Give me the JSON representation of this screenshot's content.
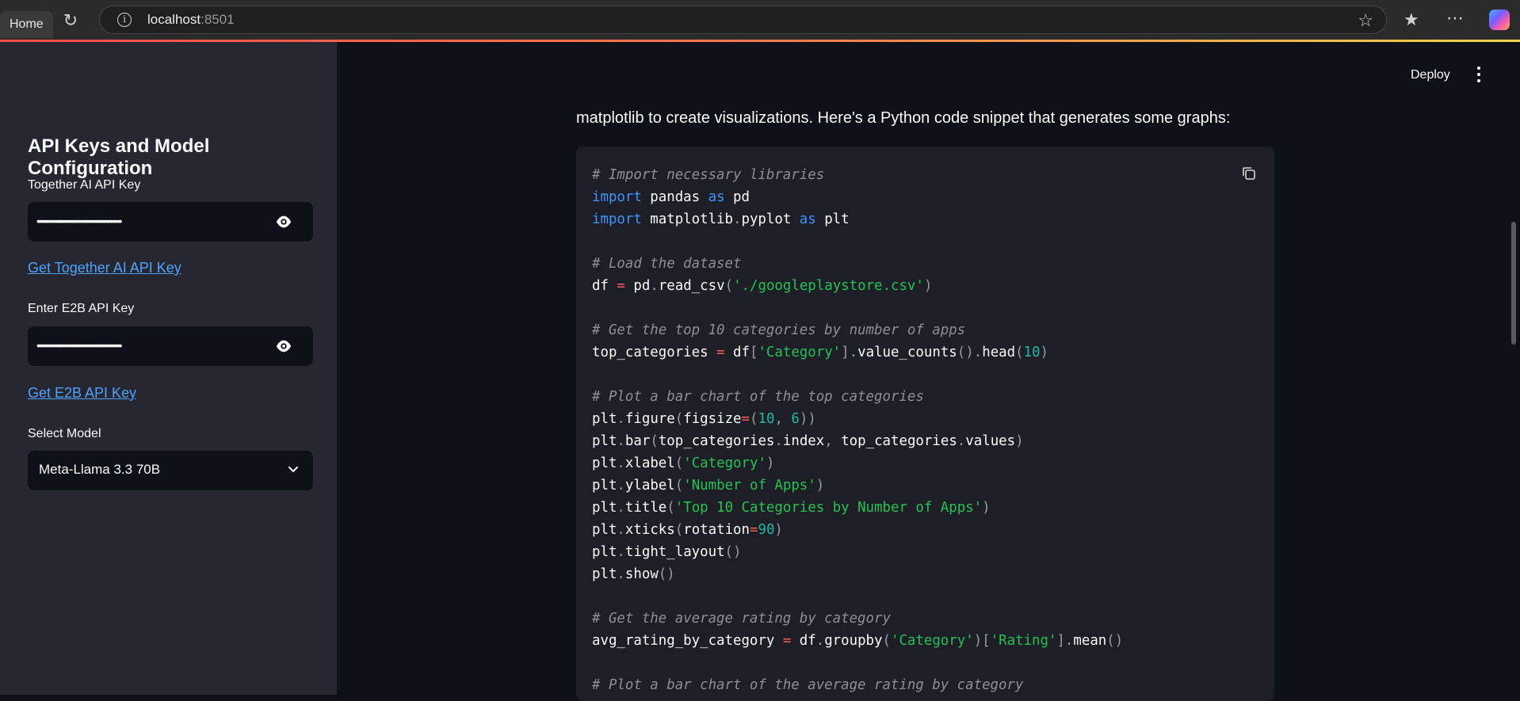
{
  "browser": {
    "tab_label": "Home",
    "url_host": "localhost",
    "url_port": ":8501"
  },
  "sidebar": {
    "title": "API Keys and Model Configuration",
    "together_label": "Together AI API Key",
    "together_value": "••••••••••••••••••••••••••••••••••••••••••••••",
    "together_link": "Get Together AI API Key",
    "e2b_label": "Enter E2B API Key",
    "e2b_value": "••••••••••••••••••••••••••••••••••••••••••••••",
    "e2b_link": "Get E2B API Key",
    "model_label": "Select Model",
    "model_value": "Meta-Llama 3.3 70B"
  },
  "header": {
    "deploy_label": "Deploy"
  },
  "main": {
    "intro_text": "matplotlib to create visualizations. Here's a Python code snippet that generates some graphs:",
    "code_lines": [
      "# Import necessary libraries",
      "import pandas as pd",
      "import matplotlib.pyplot as plt",
      "",
      "# Load the dataset",
      "df = pd.read_csv('./googleplaystore.csv')",
      "",
      "# Get the top 10 categories by number of apps",
      "top_categories = df['Category'].value_counts().head(10)",
      "",
      "# Plot a bar chart of the top categories",
      "plt.figure(figsize=(10, 6))",
      "plt.bar(top_categories.index, top_categories.values)",
      "plt.xlabel('Category')",
      "plt.ylabel('Number of Apps')",
      "plt.title('Top 10 Categories by Number of Apps')",
      "plt.xticks(rotation=90)",
      "plt.tight_layout()",
      "plt.show()",
      "",
      "# Get the average rating by category",
      "avg_rating_by_category = df.groupby('Category')['Rating'].mean()",
      "",
      "# Plot a bar chart of the average rating by category"
    ]
  },
  "colors": {
    "accent_red": "#ff4b4b",
    "link_blue": "#4ea3ff",
    "sidebar_bg": "#262730",
    "main_bg": "#0e1117"
  }
}
